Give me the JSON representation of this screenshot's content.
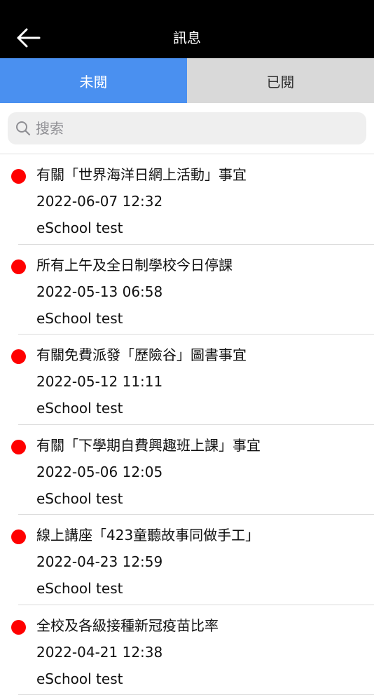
{
  "header": {
    "title": "訊息",
    "back_icon": "arrow-left-icon"
  },
  "tabs": [
    {
      "label": "未閱",
      "active": true
    },
    {
      "label": "已閱",
      "active": false
    }
  ],
  "search": {
    "placeholder": "搜索",
    "value": ""
  },
  "messages": [
    {
      "title": "有關「世界海洋日網上活動」事宜",
      "date": "2022-06-07 12:32",
      "sender": "eSchool test",
      "unread": true
    },
    {
      "title": "所有上午及全日制學校今日停課",
      "date": "2022-05-13 06:58",
      "sender": "eSchool test",
      "unread": true
    },
    {
      "title": "有關免費派發「歷險谷」圖書事宜",
      "date": "2022-05-12 11:11",
      "sender": "eSchool test",
      "unread": true
    },
    {
      "title": "有關「下學期自費興趣班上課」事宜",
      "date": "2022-05-06 12:05",
      "sender": "eSchool test",
      "unread": true
    },
    {
      "title": "線上講座「423童聽故事同做手工」",
      "date": "2022-04-23 12:59",
      "sender": "eSchool test",
      "unread": true
    },
    {
      "title": "全校及各級接種新冠疫苗比率",
      "date": "2022-04-21 12:38",
      "sender": "eSchool test",
      "unread": true
    }
  ],
  "colors": {
    "header_bg": "#000000",
    "tab_active_bg": "#4a90f0",
    "tab_inactive_bg": "#d9d9d9",
    "unread_dot": "#ff0000"
  }
}
